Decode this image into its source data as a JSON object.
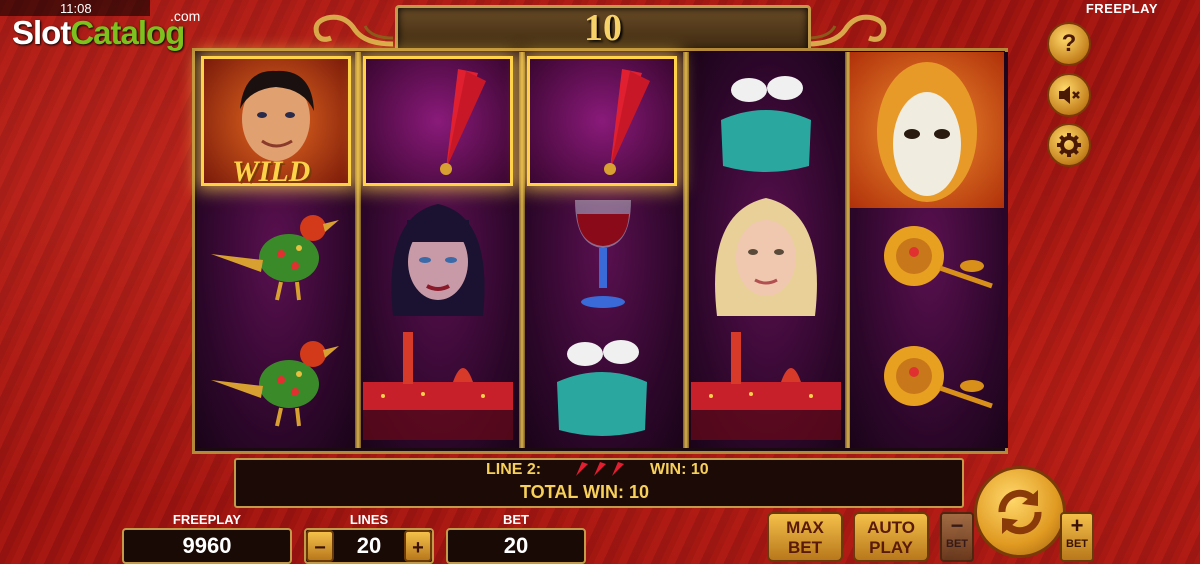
{
  "status_bar": {
    "time": "11:08",
    "mode": "FREEPLAY"
  },
  "logo": {
    "part1": "Slot",
    "part2": "Catalog",
    "suffix": ".com"
  },
  "counter": {
    "value": "10"
  },
  "side_buttons": [
    {
      "name": "help",
      "icon": "question-icon"
    },
    {
      "name": "sound",
      "icon": "speaker-muted-icon"
    },
    {
      "name": "settings",
      "icon": "gear-icon"
    }
  ],
  "reels": [
    [
      "wild-man",
      "bird",
      "bird"
    ],
    [
      "fan",
      "dark-haired-woman",
      "venice-skyline"
    ],
    [
      "fan",
      "wine-glass",
      "doves-box"
    ],
    [
      "doves-box",
      "blonde-woman",
      "venice-skyline"
    ],
    [
      "mask",
      "golden-rose",
      "golden-rose"
    ]
  ],
  "wild_text": "WILD",
  "win_info": {
    "line_label": "LINE 2:",
    "win_label": "WIN: 10",
    "total_label": "TOTAL WIN: 10"
  },
  "controls": {
    "freeplay_label": "FREEPLAY",
    "freeplay_value": "9960",
    "lines_label": "LINES",
    "lines_value": "20",
    "minus": "−",
    "plus": "+",
    "bet_label": "BET",
    "bet_value": "20",
    "max_bet": [
      "MAX",
      "BET"
    ],
    "auto_play": [
      "AUTO",
      "PLAY"
    ],
    "bet_minus_label": "BET",
    "bet_plus_label": "BET"
  },
  "colors": {
    "accent_gold": "#f6d05a",
    "frame": "#c39a4a",
    "background_red": "#a01512"
  }
}
